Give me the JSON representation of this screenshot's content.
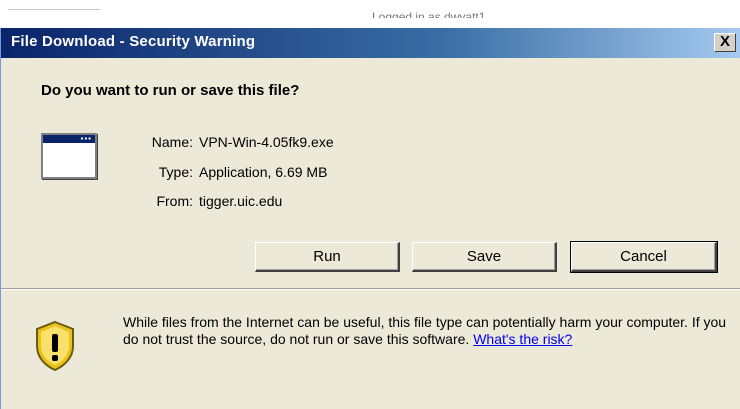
{
  "background": {
    "partial_text": "Logged in as dwyatt1"
  },
  "dialog": {
    "title": "File Download - Security Warning",
    "close_glyph": "X",
    "question": "Do you want to run or save this file?",
    "file_icon": "application-window-icon",
    "file": {
      "name_label": "Name:",
      "name_value": "VPN-Win-4.05fk9.exe",
      "type_label": "Type:",
      "type_value": "Application, 6.69 MB",
      "from_label": "From:",
      "from_value": "tigger.uic.edu"
    },
    "buttons": {
      "run": "Run",
      "save": "Save",
      "cancel": "Cancel"
    },
    "warning": {
      "icon": "security-shield-warning-icon",
      "text": "While files from the Internet can be useful, this file type can potentially harm your computer. If you do not trust the source, do not run or save this software.",
      "link": "What's the risk?"
    },
    "colors": {
      "title_bar_start": "#0a246a",
      "title_bar_end": "#a6caf0",
      "dialog_bg": "#ece9d8",
      "link": "#0000ee"
    }
  }
}
